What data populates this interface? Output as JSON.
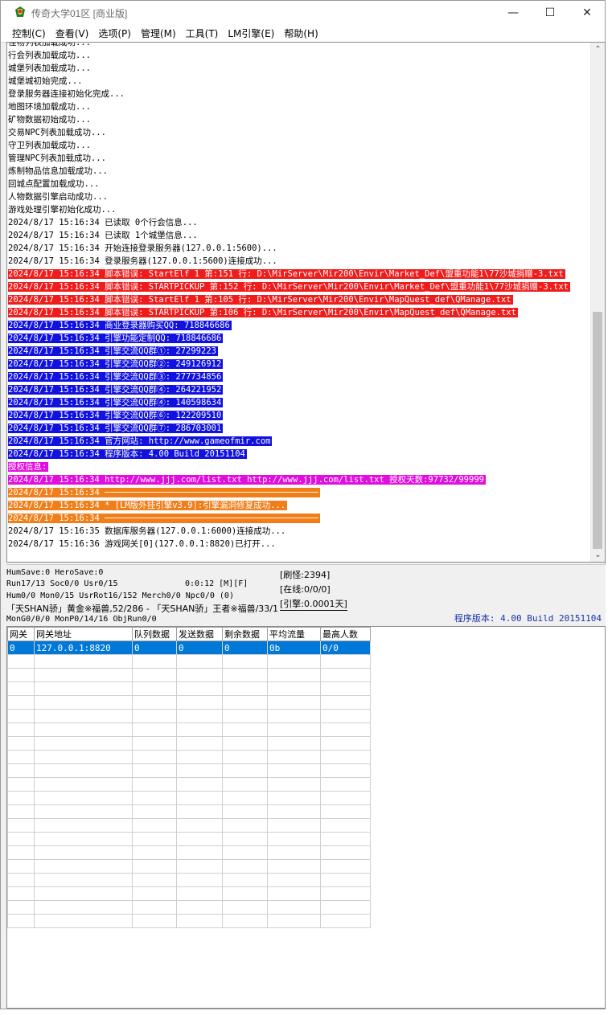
{
  "window": {
    "title": "传奇大学01区 [商业版]",
    "controls": {
      "minimize": "—",
      "maximize": "☐",
      "close": "✕"
    }
  },
  "menu": [
    "控制(C)",
    "查看(V)",
    "选项(P)",
    "管理(M)",
    "工具(T)",
    "LM引擎(E)",
    "帮助(H)"
  ],
  "colors": {
    "red_bg": "#ef1c1c",
    "red_fg": "#ffffff",
    "blue_bg": "#1111e0",
    "blue_fg": "#ffffff",
    "magenta_bg": "#e20ddf",
    "magenta_fg": "#ffffff",
    "orange_bg": "#f07f1a",
    "orange_fg": "#ffffff",
    "default_fg": "#000000",
    "selection": "#0078d7"
  },
  "log_lines": [
    {
      "text": "怪物列表加载成功...",
      "style": "plain"
    },
    {
      "text": "行会列表加载成功...",
      "style": "plain"
    },
    {
      "text": "城堡列表加载成功...",
      "style": "plain"
    },
    {
      "text": "城堡城初始完成...",
      "style": "plain"
    },
    {
      "text": "登录服务器连接初始化完成...",
      "style": "plain"
    },
    {
      "text": "地图环境加载成功...",
      "style": "plain"
    },
    {
      "text": "矿物数据初始成功...",
      "style": "plain"
    },
    {
      "text": "交易NPC列表加载成功...",
      "style": "plain"
    },
    {
      "text": "守卫列表加载成功...",
      "style": "plain"
    },
    {
      "text": "管理NPC列表加载成功...",
      "style": "plain"
    },
    {
      "text": "炼制物品信息加载成功...",
      "style": "plain"
    },
    {
      "text": "回城点配置加载成功...",
      "style": "plain"
    },
    {
      "text": "人物数据引擎启动成功...",
      "style": "plain"
    },
    {
      "text": "游戏处理引擎初始化成功...",
      "style": "plain"
    },
    {
      "text": "2024/8/17 15:16:34 已读取 0个行会信息...",
      "style": "plain"
    },
    {
      "text": "2024/8/17 15:16:34 已读取 1个城堡信息...",
      "style": "plain"
    },
    {
      "text": "2024/8/17 15:16:34 开始连接登录服务器(127.0.0.1:5600)...",
      "style": "plain"
    },
    {
      "text": "2024/8/17 15:16:34 登录服务器(127.0.0.1:5600)连接成功...",
      "style": "plain"
    },
    {
      "text": "2024/8/17 15:16:34 脚本错误: StartElf 1 第:151 行: D:\\MirServer\\Mir200\\Envir\\Market_Def\\盟重功能1\\77沙城捐赠-3.txt",
      "style": "red"
    },
    {
      "text": "2024/8/17 15:16:34 脚本错误: STARTPICKUP 第:152 行: D:\\MirServer\\Mir200\\Envir\\Market_Def\\盟重功能1\\77沙城捐赠-3.txt",
      "style": "red"
    },
    {
      "text": "2024/8/17 15:16:34 脚本错误: StartElf 1 第:105 行: D:\\MirServer\\Mir200\\Envir\\MapQuest_def\\QManage.txt",
      "style": "red"
    },
    {
      "text": "2024/8/17 15:16:34 脚本错误: STARTPICKUP 第:106 行: D:\\MirServer\\Mir200\\Envir\\MapQuest_def\\QManage.txt",
      "style": "red"
    },
    {
      "text": "2024/8/17 15:16:34 商业登录器购买QQ: 718846686",
      "style": "blue"
    },
    {
      "text": "2024/8/17 15:16:34 引擎功能定制QQ: 718846686",
      "style": "blue"
    },
    {
      "text": "2024/8/17 15:16:34 引擎交流QQ群①: 27299223",
      "style": "blue"
    },
    {
      "text": "2024/8/17 15:16:34 引擎交流QQ群②: 249126912",
      "style": "blue"
    },
    {
      "text": "2024/8/17 15:16:34 引擎交流QQ群③: 277734856",
      "style": "blue"
    },
    {
      "text": "2024/8/17 15:16:34 引擎交流QQ群④: 264221952",
      "style": "blue"
    },
    {
      "text": "2024/8/17 15:16:34 引擎交流QQ群④: 140598634",
      "style": "blue"
    },
    {
      "text": "2024/8/17 15:16:34 引擎交流QQ群⑥: 122209510",
      "style": "blue"
    },
    {
      "text": "2024/8/17 15:16:34 引擎交流QQ群⑦: 286703001",
      "style": "blue"
    },
    {
      "text": "2024/8/17 15:16:34 官方网站: http://www.gameofmir.com",
      "style": "blue"
    },
    {
      "text": "2024/8/17 15:16:34 程序版本: 4.00 Build 20151104",
      "style": "blue"
    },
    {
      "text": "授权信息:",
      "style": "magenta"
    },
    {
      "text": "2024/8/17 15:16:34 http://www.jjj.com/list.txt http://www.jjj.com/list.txt 授权天数:97732/99999",
      "style": "magenta"
    },
    {
      "text": "2024/8/17 15:16:34 ──────────────────────────────────────────",
      "style": "orange"
    },
    {
      "text": "2024/8/17 15:16:34 * [LM版外挂引擎v3.9]:引擎漏洞修复成功...",
      "style": "orange"
    },
    {
      "text": "2024/8/17 15:16:34 ──────────────────────────────────────────",
      "style": "orange"
    },
    {
      "text": "2024/8/17 15:16:35 数据库服务器(127.0.0.1:6000)连接成功...",
      "style": "plain"
    },
    {
      "text": "2024/8/17 15:16:36 游戏网关[0](127.0.0.1:8820)已打开...",
      "style": "plain"
    }
  ],
  "status": {
    "line1": "HumSave:0 HeroSave:0",
    "line2a": "Run17/13 Soc0/0 Usr0/15",
    "line2b": "0:0:12 [M][F]",
    "line3": "Hum0/0 Mon0/15 UsrRot16/152 Merch0/0 Npc0/0 (0)",
    "line4": "「天SHAN骄」黄金※福兽,52/286 - 「天SHAN骄」王者※福兽/33/1",
    "line5": "MonG0/0/0 MonP0/14/16 ObjRun0/0",
    "refresh": "[刷怪:2394]",
    "online": "[在线:0/0/0]",
    "engine": "[引擎:0.0001天]",
    "version": "程序版本: 4.00 Build 20151104"
  },
  "gateway_table": {
    "headers": [
      "网关",
      "网关地址",
      "队列数据",
      "发送数据",
      "剩余数据",
      "平均流量",
      "最高人数"
    ],
    "rows": [
      [
        "0",
        "127.0.0.1:8820",
        "0",
        "0",
        "0",
        "0b",
        "0/0"
      ]
    ],
    "empty_rows": 20
  }
}
